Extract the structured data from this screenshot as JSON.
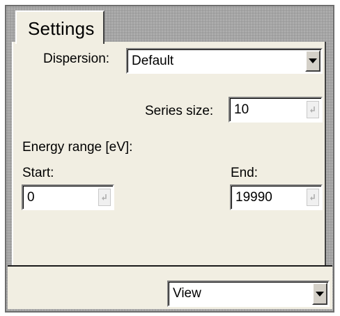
{
  "tabs": [
    {
      "label": "Settings",
      "active": true
    }
  ],
  "dispersion": {
    "label": "Dispersion:",
    "value": "Default"
  },
  "series_size": {
    "label": "Series size:",
    "value": "10"
  },
  "energy_range": {
    "label": "Energy range [eV]:",
    "start": {
      "label": "Start:",
      "value": "0"
    },
    "end": {
      "label": "End:",
      "value": "19990"
    }
  },
  "view": {
    "value": "View"
  },
  "icons": {
    "spin": "spin-icon",
    "dropdown": "chevron-down-icon"
  },
  "colors": {
    "panel": "#f1eee2",
    "frame": "#a5a5a5",
    "field": "#ffffff",
    "button": "#d4d0c8"
  }
}
